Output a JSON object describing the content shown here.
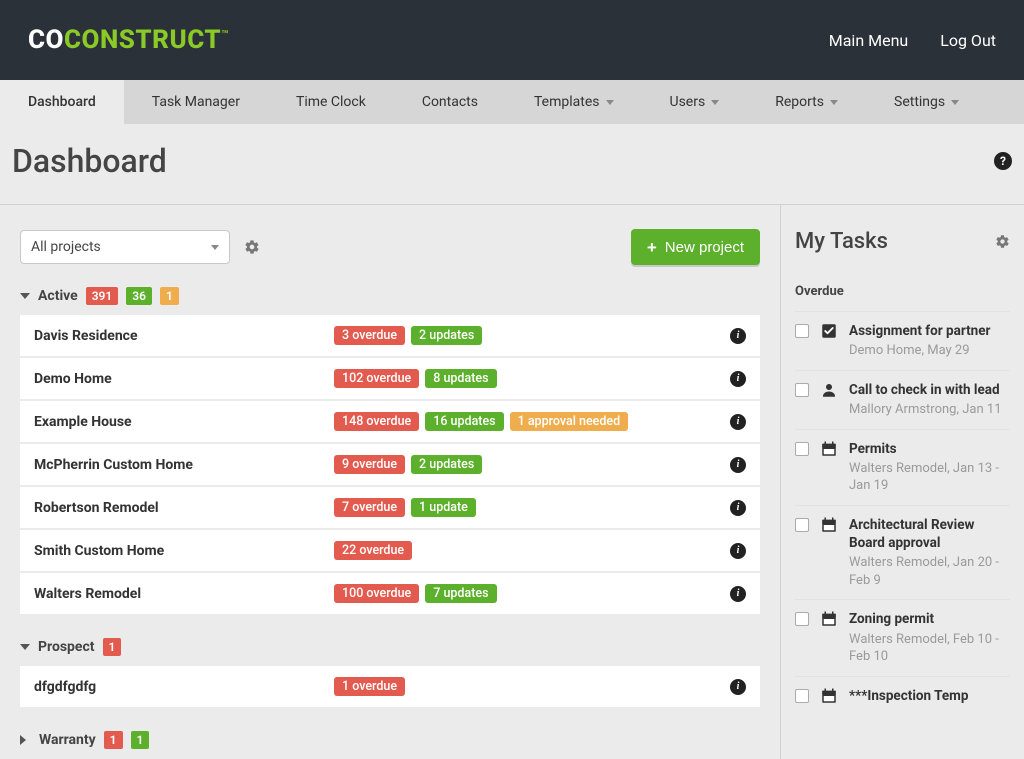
{
  "brand": {
    "co": "CO",
    "construct": "CONSTRUCT",
    "tm": "™"
  },
  "top_nav": {
    "main_menu": "Main Menu",
    "log_out": "Log Out"
  },
  "tabs": [
    {
      "label": "Dashboard",
      "active": true,
      "caret": false
    },
    {
      "label": "Task Manager",
      "active": false,
      "caret": false
    },
    {
      "label": "Time Clock",
      "active": false,
      "caret": false
    },
    {
      "label": "Contacts",
      "active": false,
      "caret": false
    },
    {
      "label": "Templates",
      "active": false,
      "caret": true
    },
    {
      "label": "Users",
      "active": false,
      "caret": true
    },
    {
      "label": "Reports",
      "active": false,
      "caret": true
    },
    {
      "label": "Settings",
      "active": false,
      "caret": true
    }
  ],
  "page_title": "Dashboard",
  "project_filter": "All projects",
  "new_project_label": "New project",
  "sections": {
    "active": {
      "label": "Active",
      "counts": {
        "red": "391",
        "green": "36",
        "amber": "1"
      },
      "rows": [
        {
          "name": "Davis Residence",
          "overdue": "3 overdue",
          "updates": "2 updates",
          "approval": null
        },
        {
          "name": "Demo Home",
          "overdue": "102 overdue",
          "updates": "8 updates",
          "approval": null
        },
        {
          "name": "Example House",
          "overdue": "148 overdue",
          "updates": "16 updates",
          "approval": "1 approval needed"
        },
        {
          "name": "McPherrin Custom Home",
          "overdue": "9 overdue",
          "updates": "2 updates",
          "approval": null
        },
        {
          "name": "Robertson Remodel",
          "overdue": "7 overdue",
          "updates": "1 update",
          "approval": null
        },
        {
          "name": "Smith Custom Home",
          "overdue": "22 overdue",
          "updates": null,
          "approval": null
        },
        {
          "name": "Walters Remodel",
          "overdue": "100 overdue",
          "updates": "7 updates",
          "approval": null
        }
      ]
    },
    "prospect": {
      "label": "Prospect",
      "counts": {
        "red": "1"
      },
      "rows": [
        {
          "name": "dfgdfgdfg",
          "overdue": "1 overdue",
          "updates": null,
          "approval": null
        }
      ]
    },
    "warranty": {
      "label": "Warranty",
      "counts": {
        "red": "1",
        "green": "1"
      }
    }
  },
  "my_tasks": {
    "title": "My Tasks",
    "group_label": "Overdue",
    "tasks": [
      {
        "icon": "check",
        "title": "Assignment for partner",
        "sub": "Demo Home, May 29"
      },
      {
        "icon": "person",
        "title": "Call to check in with lead",
        "sub": "Mallory Armstrong, Jan 11"
      },
      {
        "icon": "calendar",
        "title": "Permits",
        "sub": "Walters Remodel, Jan 13 - Jan 19"
      },
      {
        "icon": "calendar",
        "title": "Architectural Review Board approval",
        "sub": "Walters Remodel, Jan 20 - Feb 9"
      },
      {
        "icon": "calendar",
        "title": "Zoning permit",
        "sub": "Walters Remodel, Feb 10 - Feb 10"
      },
      {
        "icon": "calendar",
        "title": "***Inspection Temp",
        "sub": ""
      }
    ]
  }
}
